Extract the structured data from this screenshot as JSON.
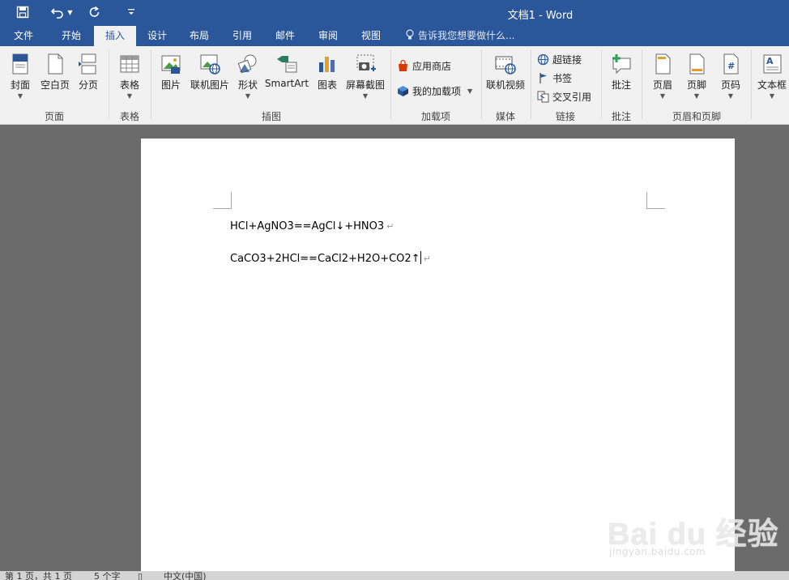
{
  "window": {
    "title": "文档1 - Word"
  },
  "colors": {
    "brand": "#2b579a",
    "ribbon_bg": "#f1f1f1",
    "workspace": "#6b6b6b"
  },
  "qat": {
    "save_icon": "save-icon",
    "undo_icon": "undo-icon",
    "redo_icon": "redo-icon",
    "customize_icon": "customize-qat-icon"
  },
  "tabs": [
    "文件",
    "开始",
    "插入",
    "设计",
    "布局",
    "引用",
    "邮件",
    "审阅",
    "视图"
  ],
  "active_tab": "插入",
  "tell_me": {
    "placeholder": "告诉我您想要做什么..."
  },
  "ribbon": {
    "pages": {
      "label": "页面",
      "cover": "封面",
      "blank_page": "空白页",
      "page_break": "分页"
    },
    "tables": {
      "label": "表格",
      "table": "表格"
    },
    "illustrations": {
      "label": "插图",
      "pictures": "图片",
      "online_pictures": "联机图片",
      "shapes": "形状",
      "smartart": "SmartArt",
      "chart": "图表",
      "screenshot": "屏幕截图"
    },
    "addins": {
      "label": "加载项",
      "store": "应用商店",
      "my_addins": "我的加载项"
    },
    "media": {
      "label": "媒体",
      "online_video": "联机视频"
    },
    "links": {
      "label": "链接",
      "hyperlink": "超链接",
      "bookmark": "书签",
      "cross_reference": "交叉引用"
    },
    "comments": {
      "label": "批注",
      "comment": "批注"
    },
    "header_footer": {
      "label": "页眉和页脚",
      "header": "页眉",
      "footer": "页脚",
      "page_number": "页码"
    },
    "text": {
      "text_box": "文本框"
    }
  },
  "document": {
    "lines": [
      "HCl+AgNO3==AgCl↓+HNO3",
      "CaCO3+2HCl==CaCl2+H2O+CO2↑"
    ],
    "pilcrow": "↵"
  },
  "statusbar": {
    "page": "第 1 页，共 1 页",
    "words": "5 个字",
    "language": "中文(中国)"
  },
  "watermark": {
    "brand": "Bai du 经验",
    "url": "jingyan.baidu.com"
  }
}
